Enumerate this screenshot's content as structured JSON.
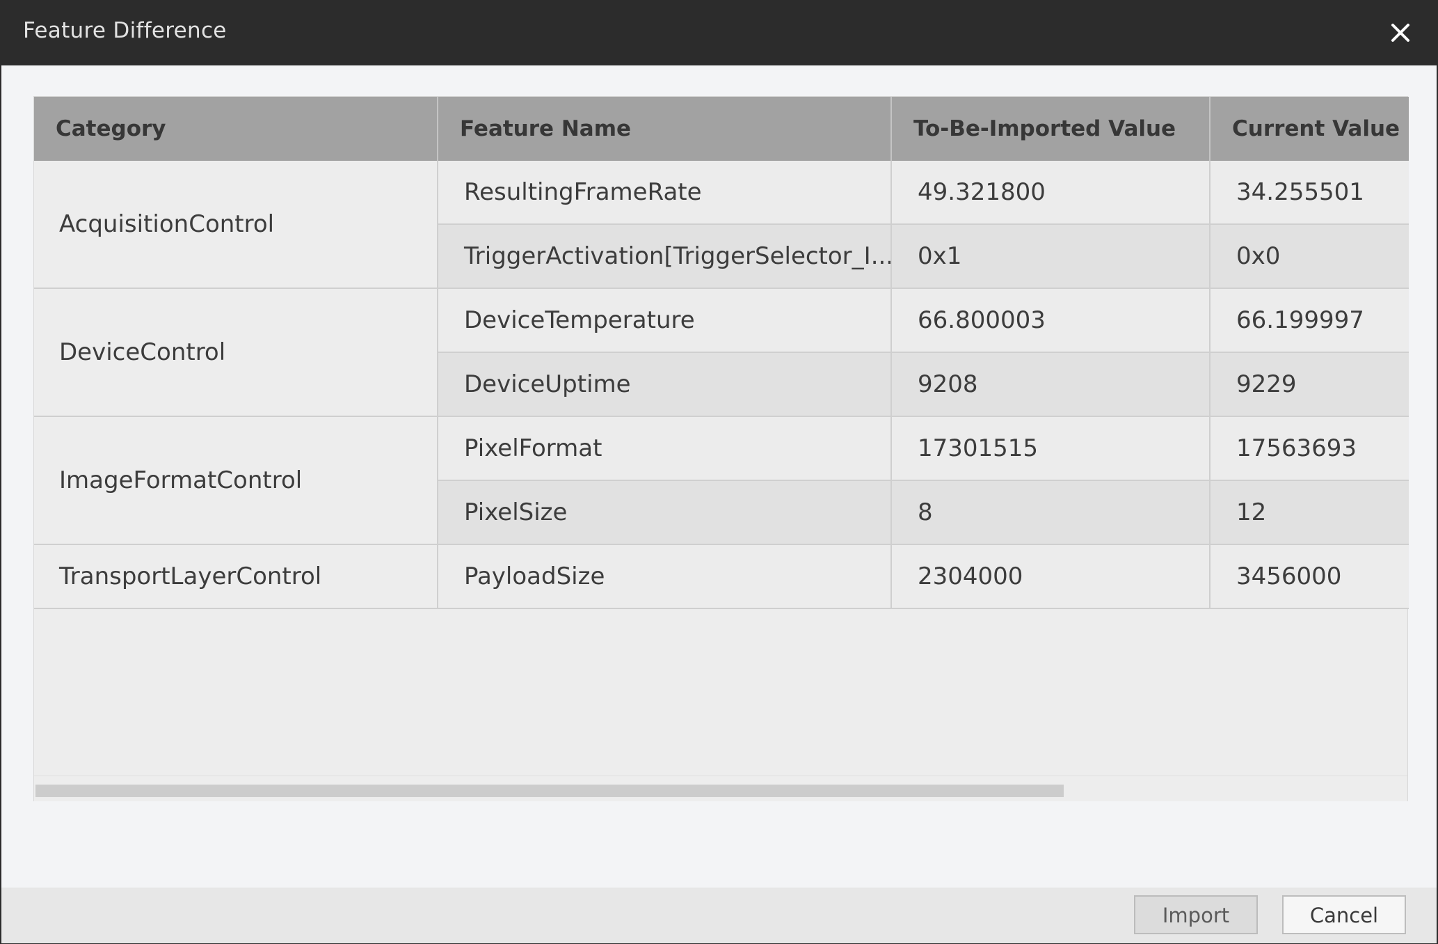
{
  "dialog": {
    "title": "Feature Difference",
    "close_icon": "close-icon"
  },
  "table": {
    "columns": [
      "Category",
      "Feature Name",
      "To-Be-Imported Value",
      "Current Value"
    ],
    "groups": [
      {
        "category": "AcquisitionControl",
        "rows": [
          {
            "feature": "ResultingFrameRate",
            "imported": "49.321800",
            "current": "34.255501"
          },
          {
            "feature": "TriggerActivation[TriggerSelector_I...",
            "imported": "0x1",
            "current": "0x0"
          }
        ]
      },
      {
        "category": "DeviceControl",
        "rows": [
          {
            "feature": "DeviceTemperature",
            "imported": "66.800003",
            "current": "66.199997"
          },
          {
            "feature": "DeviceUptime",
            "imported": "9208",
            "current": "9229"
          }
        ]
      },
      {
        "category": "ImageFormatControl",
        "rows": [
          {
            "feature": "PixelFormat",
            "imported": "17301515",
            "current": "17563693"
          },
          {
            "feature": "PixelSize",
            "imported": "8",
            "current": "12"
          }
        ]
      },
      {
        "category": "TransportLayerControl",
        "rows": [
          {
            "feature": "PayloadSize",
            "imported": "2304000",
            "current": "3456000"
          }
        ]
      }
    ]
  },
  "footer": {
    "import_label": "Import",
    "cancel_label": "Cancel"
  }
}
